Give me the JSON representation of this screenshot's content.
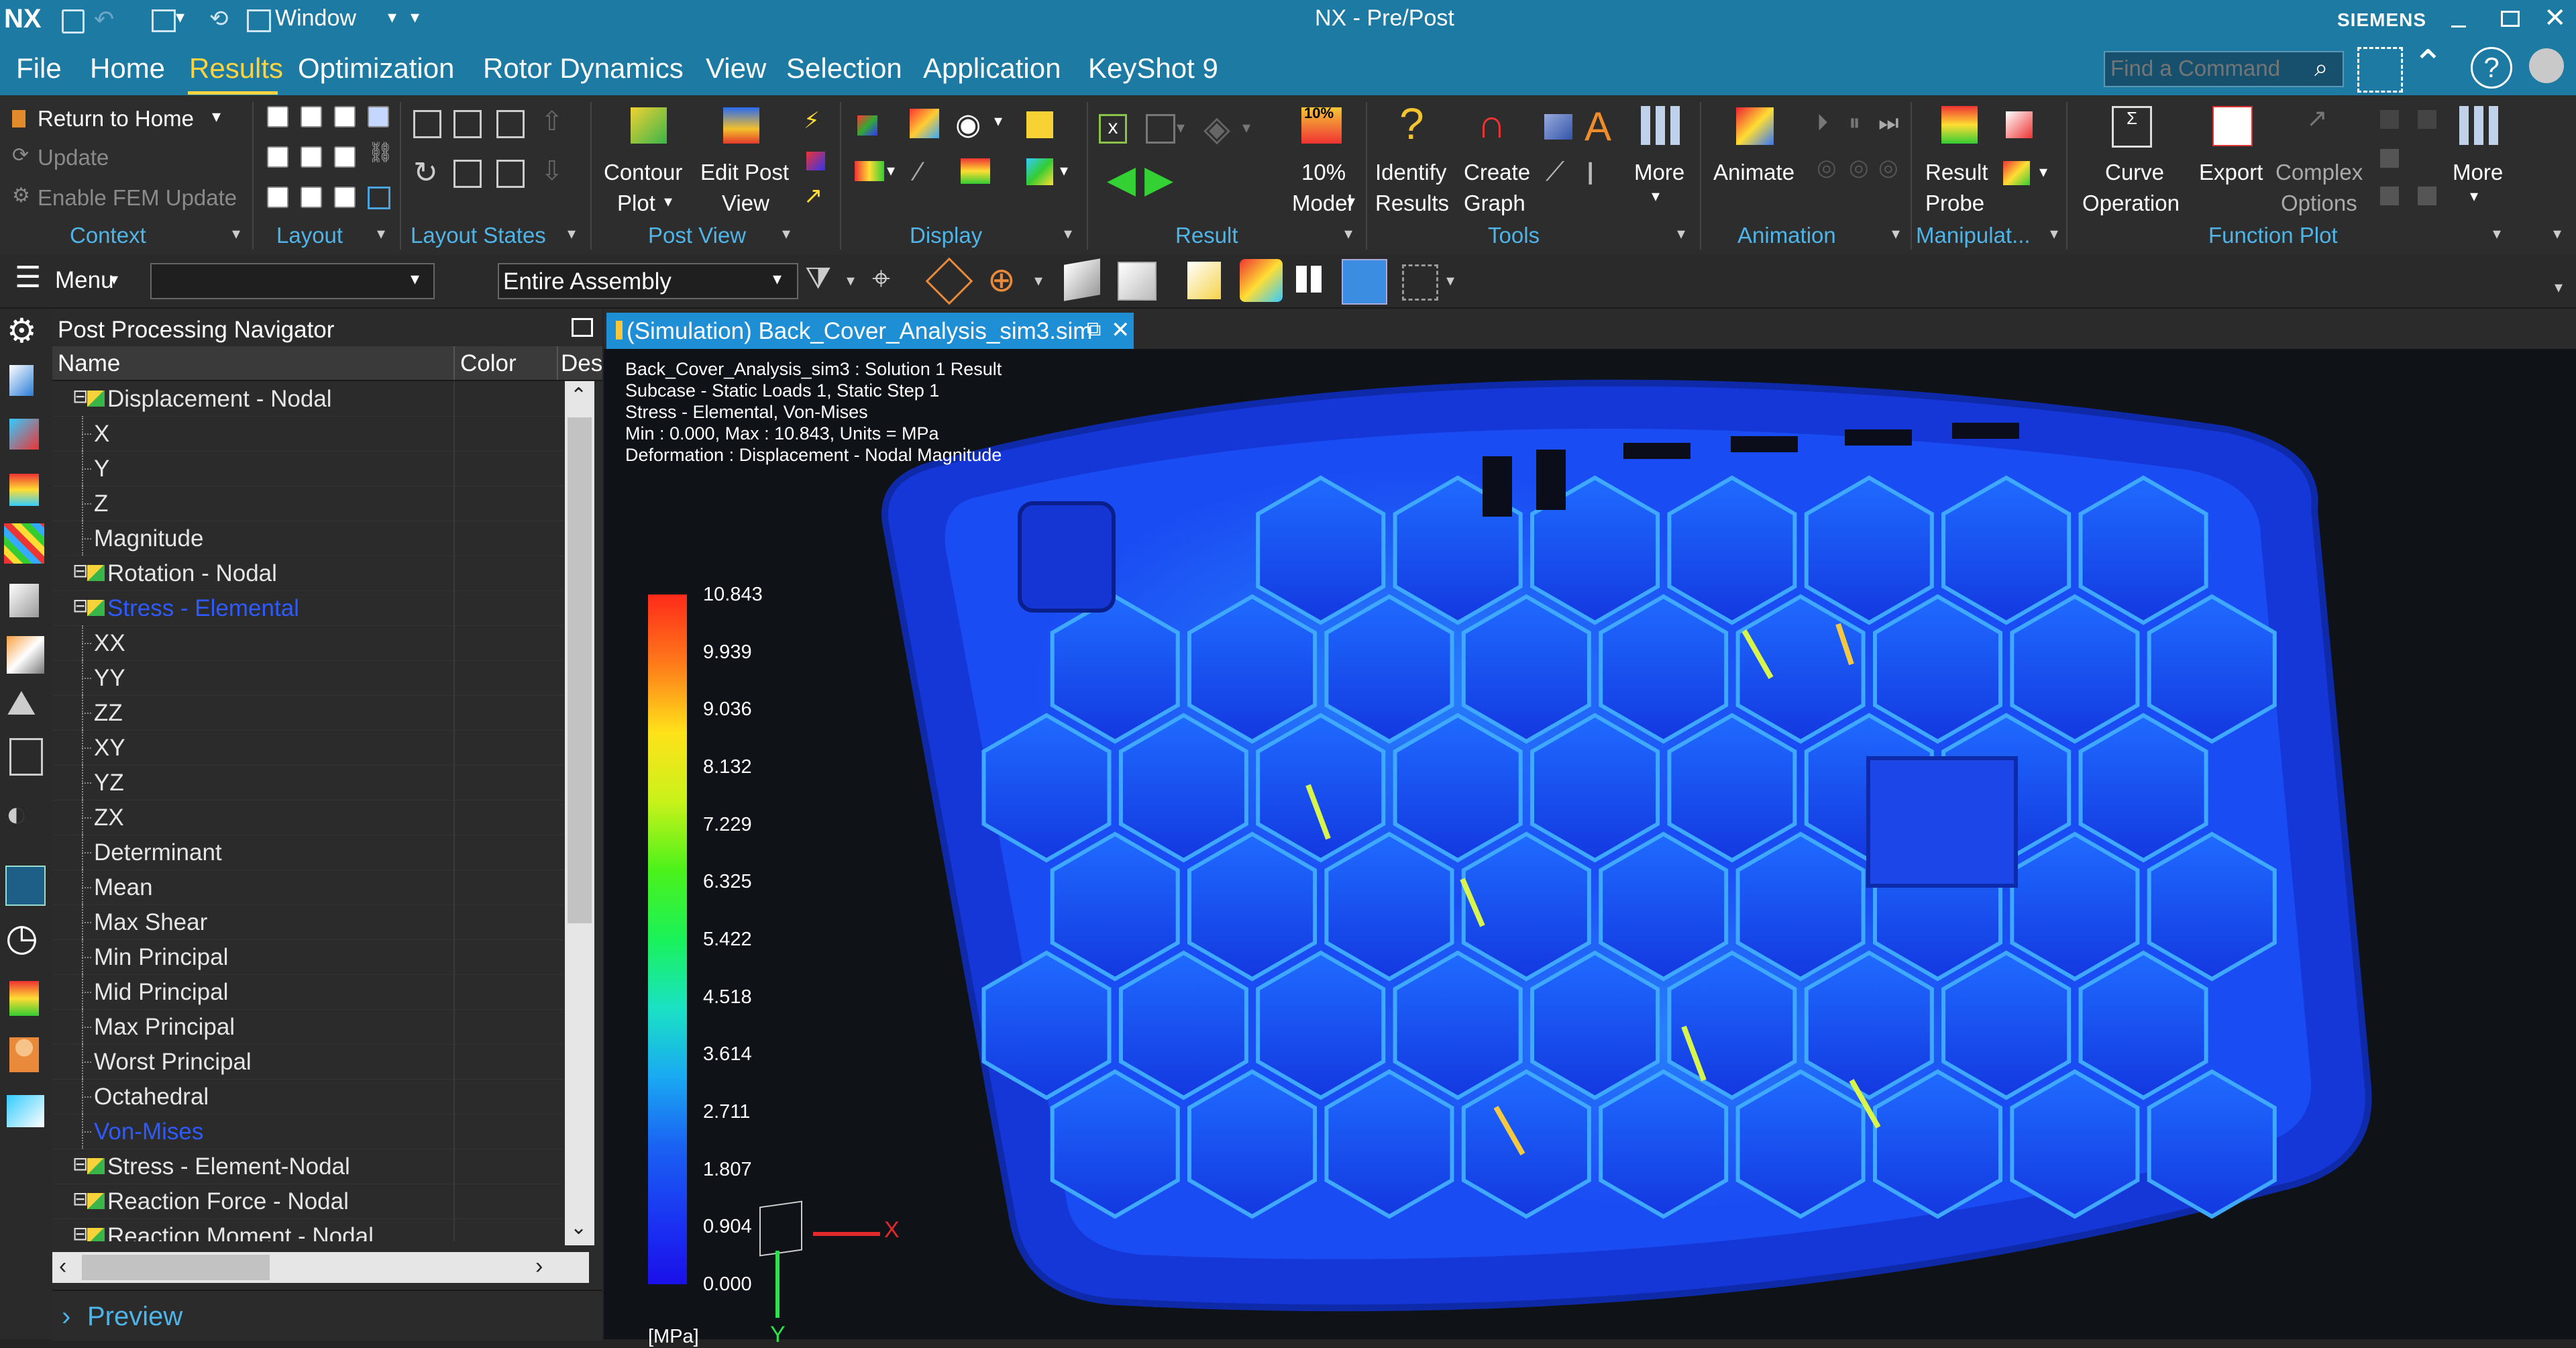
{
  "titlebar": {
    "app_logo": "NX",
    "window_menu": "Window",
    "title": "NX - Pre/Post",
    "brand": "SIEMENS"
  },
  "menubar": {
    "items": [
      "File",
      "Home",
      "Results",
      "Optimization",
      "Rotor Dynamics",
      "View",
      "Selection",
      "Application",
      "KeyShot 9"
    ],
    "active": "Results",
    "search_placeholder": "Find a Command"
  },
  "ribbon": {
    "context": {
      "return_home": "Return to Home",
      "update": "Update",
      "enable_fem": "Enable FEM Update",
      "label": "Context"
    },
    "layout_label": "Layout",
    "layout_states_label": "Layout States",
    "post_view": {
      "contour_plot": [
        "Contour",
        "Plot"
      ],
      "edit_post_view": [
        "Edit Post",
        "View"
      ],
      "label": "Post View"
    },
    "display_label": "Display",
    "result": {
      "model_pct_icon": "10%",
      "model_pct": [
        "10%",
        "Model"
      ],
      "label": "Result"
    },
    "tools": {
      "identify": [
        "Identify",
        "Results"
      ],
      "create_graph": [
        "Create",
        "Graph"
      ],
      "more": "More",
      "label": "Tools"
    },
    "animation": {
      "animate": "Animate",
      "label": "Animation"
    },
    "manipulate": {
      "result_probe": [
        "Result",
        "Probe"
      ],
      "label": "Manipulat..."
    },
    "function_plot": {
      "curve_op": [
        "Curve",
        "Operation"
      ],
      "export": "Export",
      "complex": [
        "Complex",
        "Options"
      ],
      "more": "More",
      "label": "Function Plot"
    }
  },
  "selbar": {
    "menu": "Menu",
    "filter_value": "",
    "assembly": "Entire Assembly"
  },
  "navigator": {
    "title": "Post Processing Navigator",
    "columns": [
      "Name",
      "Color",
      "Des"
    ],
    "rows": [
      {
        "label": "Displacement - Nodal",
        "level": 1,
        "expander": true,
        "icon": true,
        "highlight": false
      },
      {
        "label": "X",
        "level": 2
      },
      {
        "label": "Y",
        "level": 2
      },
      {
        "label": "Z",
        "level": 2
      },
      {
        "label": "Magnitude",
        "level": 2
      },
      {
        "label": "Rotation - Nodal",
        "level": 1,
        "expander": true,
        "icon": true
      },
      {
        "label": "Stress - Elemental",
        "level": 1,
        "expander": true,
        "icon": true,
        "highlight": true
      },
      {
        "label": "XX",
        "level": 2
      },
      {
        "label": "YY",
        "level": 2
      },
      {
        "label": "ZZ",
        "level": 2
      },
      {
        "label": "XY",
        "level": 2
      },
      {
        "label": "YZ",
        "level": 2
      },
      {
        "label": "ZX",
        "level": 2
      },
      {
        "label": "Determinant",
        "level": 2
      },
      {
        "label": "Mean",
        "level": 2
      },
      {
        "label": "Max Shear",
        "level": 2
      },
      {
        "label": "Min Principal",
        "level": 2
      },
      {
        "label": "Mid Principal",
        "level": 2
      },
      {
        "label": "Max Principal",
        "level": 2
      },
      {
        "label": "Worst Principal",
        "level": 2
      },
      {
        "label": "Octahedral",
        "level": 2
      },
      {
        "label": "Von-Mises",
        "level": 2,
        "highlight": true
      },
      {
        "label": "Stress - Element-Nodal",
        "level": 1,
        "expander": true,
        "icon": true
      },
      {
        "label": "Reaction Force - Nodal",
        "level": 1,
        "expander": true,
        "icon": true
      },
      {
        "label": "Reaction Moment - Nodal",
        "level": 1,
        "expander": true,
        "icon": true
      }
    ],
    "preview": "Preview"
  },
  "viewport": {
    "tab_label": "(Simulation) Back_Cover_Analysis_sim3.sim",
    "info_lines": [
      "Back_Cover_Analysis_sim3 : Solution 1 Result",
      "Subcase - Static Loads 1, Static Step 1",
      "Stress - Elemental, Von-Mises",
      "Min : 0.000, Max : 10.843, Units = MPa",
      "Deformation : Displacement - Nodal Magnitude"
    ],
    "legend_values": [
      "10.843",
      "9.939",
      "9.036",
      "8.132",
      "7.229",
      "6.325",
      "5.422",
      "4.518",
      "3.614",
      "2.711",
      "1.807",
      "0.904",
      "0.000"
    ],
    "legend_unit": "[MPa]",
    "triad_x": "X",
    "triad_y": "Y"
  },
  "colors": {
    "accent_blue": "#1d7aa3",
    "highlight_text": "#2d5bff",
    "group_label": "#4fb4e8"
  }
}
